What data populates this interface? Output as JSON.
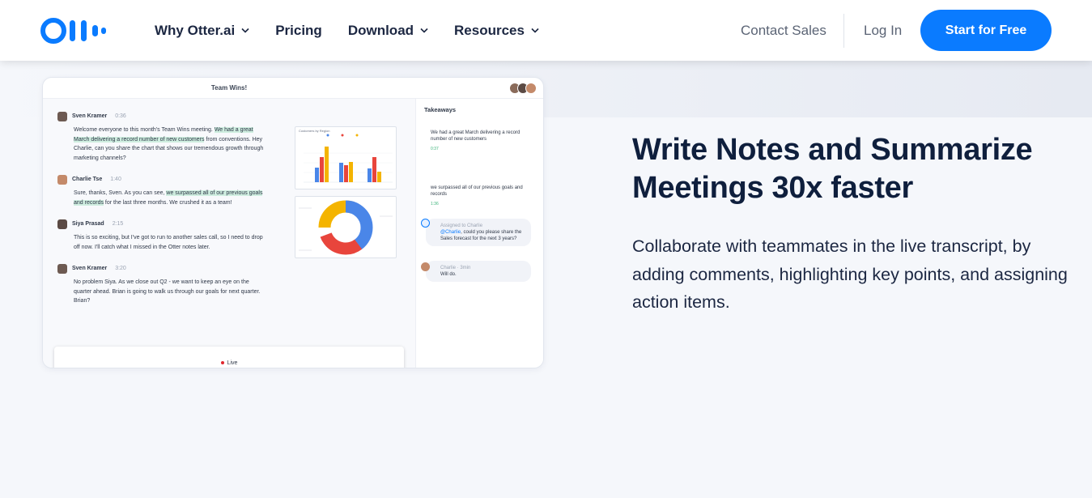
{
  "header": {
    "logo_name": "Otter.ai",
    "nav": [
      {
        "label": "Why Otter.ai",
        "has_dropdown": true
      },
      {
        "label": "Pricing",
        "has_dropdown": false
      },
      {
        "label": "Download",
        "has_dropdown": true
      },
      {
        "label": "Resources",
        "has_dropdown": true
      }
    ],
    "contact_sales": "Contact Sales",
    "login": "Log In",
    "cta": "Start for Free"
  },
  "colors": {
    "brand_blue": "#0a7bff",
    "heading_navy": "#0f1f3d",
    "highlight_green": "#cfeee0"
  },
  "mockup": {
    "title": "Team Wins!",
    "messages": [
      {
        "speaker": "Sven Kramer",
        "time": "0:36",
        "pre": "Welcome everyone to this month's Team Wins meeting. ",
        "highlight": "We had a great March delivering a record number of new customers",
        "post": " from conventions. Hey Charlie, can you share the chart that shows our tremendous growth through marketing channels?"
      },
      {
        "speaker": "Charlie Tse",
        "time": "1:40",
        "pre": "Sure, thanks, Sven. As you can see, ",
        "highlight": "we surpassed all of our previous goals and records",
        "post": " for the last three months. We crushed it as a team!"
      },
      {
        "speaker": "Siya Prasad",
        "time": "2:15",
        "pre": "This is so exciting, but I've got to run to another sales call, so I need to drop off now. I'll catch what I missed in the Otter notes later.",
        "highlight": "",
        "post": ""
      },
      {
        "speaker": "Sven Kramer",
        "time": "3:20",
        "pre": "No problem Siya. As we close out Q2 - we want to keep an eye on the quarter ahead. Brian is going to walk us through our goals for next quarter. Brian?",
        "highlight": "",
        "post": ""
      }
    ],
    "chart_title": "Customers by Region",
    "live_label": "Live",
    "takeaways": {
      "title": "Takeaways",
      "items": [
        {
          "text": "We had a great March delivering a record number of new customers",
          "time": "0:37"
        },
        {
          "text": "we surpassed all of our previous goals and records",
          "time": "1:36"
        }
      ],
      "assigned": {
        "label": "Assigned to Charlie",
        "mention": "@Charlie",
        "text": ", could you please share the Sales forecast for the next 3 years?"
      },
      "reply": {
        "author": "Charlie · 3min",
        "text": "Will do."
      }
    }
  },
  "hero": {
    "heading": "Write Notes and Summarize Meetings 30x faster",
    "subheading": "Collaborate with teammates in the live transcript, by adding comments, highlighting key points, and assigning action items."
  }
}
